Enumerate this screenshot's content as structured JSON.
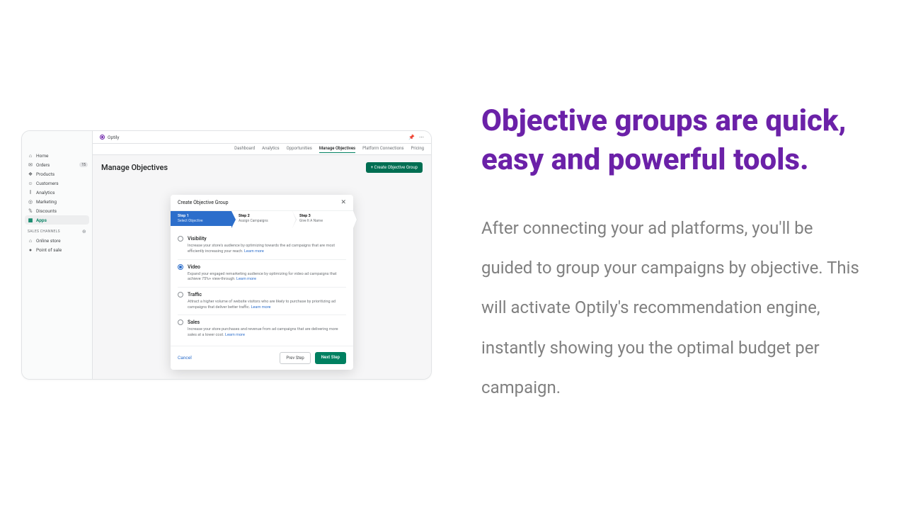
{
  "marketing": {
    "headline": "Objective groups are quick, easy and powerful tools.",
    "body": "After connecting your ad platforms, you'll be guided to group your campaigns by objective. This will activate Optily's recommendation engine, instantly showing you the optimal budget per campaign."
  },
  "app": {
    "name": "Optily",
    "sidebar": {
      "items": [
        {
          "label": "Home",
          "icon": "⌂"
        },
        {
          "label": "Orders",
          "icon": "✉",
          "badge": "15"
        },
        {
          "label": "Products",
          "icon": "❖"
        },
        {
          "label": "Customers",
          "icon": "☺"
        },
        {
          "label": "Analytics",
          "icon": "⫾"
        },
        {
          "label": "Marketing",
          "icon": "◎"
        },
        {
          "label": "Discounts",
          "icon": "%"
        },
        {
          "label": "Apps",
          "icon": "▦",
          "active": true
        }
      ],
      "channels_header": "SALES CHANNELS",
      "channels": [
        {
          "label": "Online store",
          "icon": "⌂"
        },
        {
          "label": "Point of sale",
          "icon": "●"
        }
      ]
    },
    "top_tabs": [
      "Dashboard",
      "Analytics",
      "Opportunities",
      "Manage Objectives",
      "Platform Connections",
      "Pricing"
    ],
    "active_tab": "Manage Objectives",
    "page_title": "Manage Objectives",
    "create_button": "+ Create Objective Group"
  },
  "modal": {
    "title": "Create Objective Group",
    "steps": [
      {
        "num": "Step 1",
        "label": "Select Objective",
        "active": true
      },
      {
        "num": "Step 2",
        "label": "Assign Campaigns"
      },
      {
        "num": "Step 3",
        "label": "Give It A Name"
      }
    ],
    "options": [
      {
        "title": "Visibility",
        "desc": "Increase your store's audience by optimizing towards the ad campaigns that are most efficiently increasing your reach.",
        "learn": "Learn more"
      },
      {
        "title": "Video",
        "desc": "Expand your engaged remarketing audience by optimizing for video ad campaigns that achieve 75%+ view-through.",
        "learn": "Learn more",
        "selected": true
      },
      {
        "title": "Traffic",
        "desc": "Attract a higher volume of website visitors who are likely to purchase by prioritizing ad campaigns that deliver better traffic.",
        "learn": "Learn more"
      },
      {
        "title": "Sales",
        "desc": "Increase your store purchases and revenue from ad campaigns that are delivering more sales at a lower cost.",
        "learn": "Learn more"
      }
    ],
    "cancel": "Cancel",
    "prev": "Prev Step",
    "next": "Next Step"
  }
}
